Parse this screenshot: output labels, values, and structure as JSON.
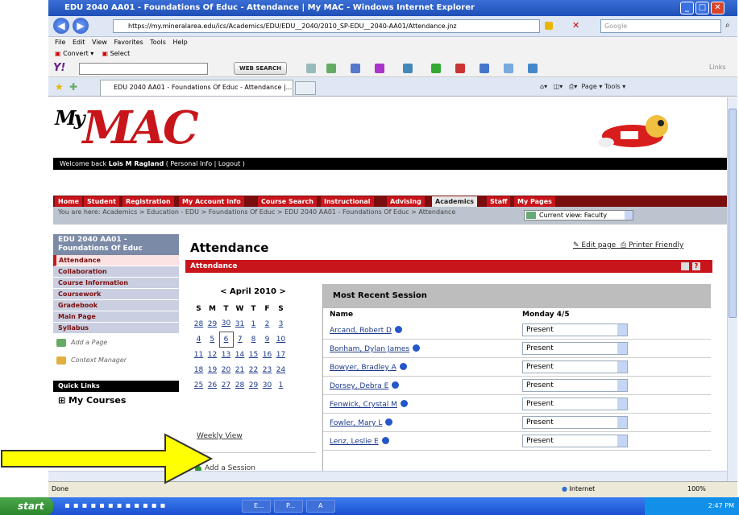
{
  "window": {
    "title": "EDU 2040 AA01 - Foundations Of Educ - Attendance | My MAC - Windows Internet Explorer",
    "url": "https://my.mineralarea.edu/ics/Academics/EDU/EDU__2040/2010_SP-EDU__2040-AA01/Attendance.jnz",
    "search_placeholder": "Google",
    "menu": [
      "File",
      "Edit",
      "View",
      "Favorites",
      "Tools",
      "Help"
    ],
    "toolbar1": [
      "Convert",
      "Select"
    ],
    "web_search_button": "WEB SEARCH",
    "links_label": "Links",
    "tab_title": "EDU 2040 AA01 - Foundations Of Educ - Attendance |...",
    "right_commands": "Page ▾   Tools ▾"
  },
  "site": {
    "logo_prefix": "My",
    "logo_text": "MAC",
    "welcome_prefix": "Welcome back ",
    "welcome_user": "Lois M Ragland",
    "welcome_links": " ( Personal Info | Logout )",
    "nav": [
      "Home",
      "Student",
      "Registration",
      "My Account Info",
      "Course Search",
      "Instructional",
      "Advising",
      "Academics",
      "Staff",
      "My Pages"
    ],
    "breadcrumb": "You are here: Academics > Education - EDU > Foundations Of Educ > EDU 2040 AA01 - Foundations Of Educ > Attendance",
    "current_view": "Current view: Faculty"
  },
  "sidebar": {
    "course": "EDU 2040 AA01 - Foundations Of Educ",
    "items": [
      "Attendance",
      "Collaboration",
      "Course Information",
      "Coursework",
      "Gradebook",
      "Main Page",
      "Syllabus"
    ],
    "add_page": "Add a Page",
    "context_manager": "Context Manager",
    "quick_links": "Quick Links",
    "my_courses": "⊞ My Courses"
  },
  "main": {
    "page_title": "Attendance",
    "edit_page": "Edit page",
    "printer_friendly": "Printer Friendly",
    "portlet_title": "Attendance",
    "calendar": {
      "prev": "<",
      "month": "April 2010",
      "next": ">",
      "days": [
        "S",
        "M",
        "T",
        "W",
        "T",
        "F",
        "S"
      ],
      "weeks": [
        [
          "28",
          "29",
          "30",
          "31",
          "1",
          "2",
          "3"
        ],
        [
          "4",
          "5",
          "6",
          "7",
          "8",
          "9",
          "10"
        ],
        [
          "11",
          "12",
          "13",
          "14",
          "15",
          "16",
          "17"
        ],
        [
          "18",
          "19",
          "20",
          "21",
          "22",
          "23",
          "24"
        ],
        [
          "25",
          "26",
          "27",
          "28",
          "29",
          "30",
          "1"
        ]
      ],
      "today": "6",
      "weekly_view": "Weekly View",
      "add_session": "Add a Session"
    },
    "session": {
      "title": "Most Recent Session",
      "col_name": "Name",
      "col_date": "Monday 4/5",
      "students": [
        {
          "name": "Arcand, Robert D",
          "status": "Present"
        },
        {
          "name": "Bonham, Dylan James",
          "status": "Present"
        },
        {
          "name": "Bowyer, Bradley A",
          "status": "Present"
        },
        {
          "name": "Dorsey, Debra E",
          "status": "Present"
        },
        {
          "name": "Fenwick, Crystal M",
          "status": "Present"
        },
        {
          "name": "Fowler, Mary L",
          "status": "Present"
        },
        {
          "name": "Lenz, Leslie E",
          "status": "Present"
        }
      ]
    }
  },
  "statusbar": {
    "left": "Done",
    "zone": "Internet",
    "zoom": "100%"
  },
  "taskbar": {
    "start": "start",
    "buttons": [
      "E...",
      "P...",
      "A"
    ],
    "clock": "2:47 PM"
  },
  "colors": {
    "brand_red": "#c8151b",
    "nav_dark": "#7a0d0d",
    "arrow_yellow": "#ffff00"
  }
}
